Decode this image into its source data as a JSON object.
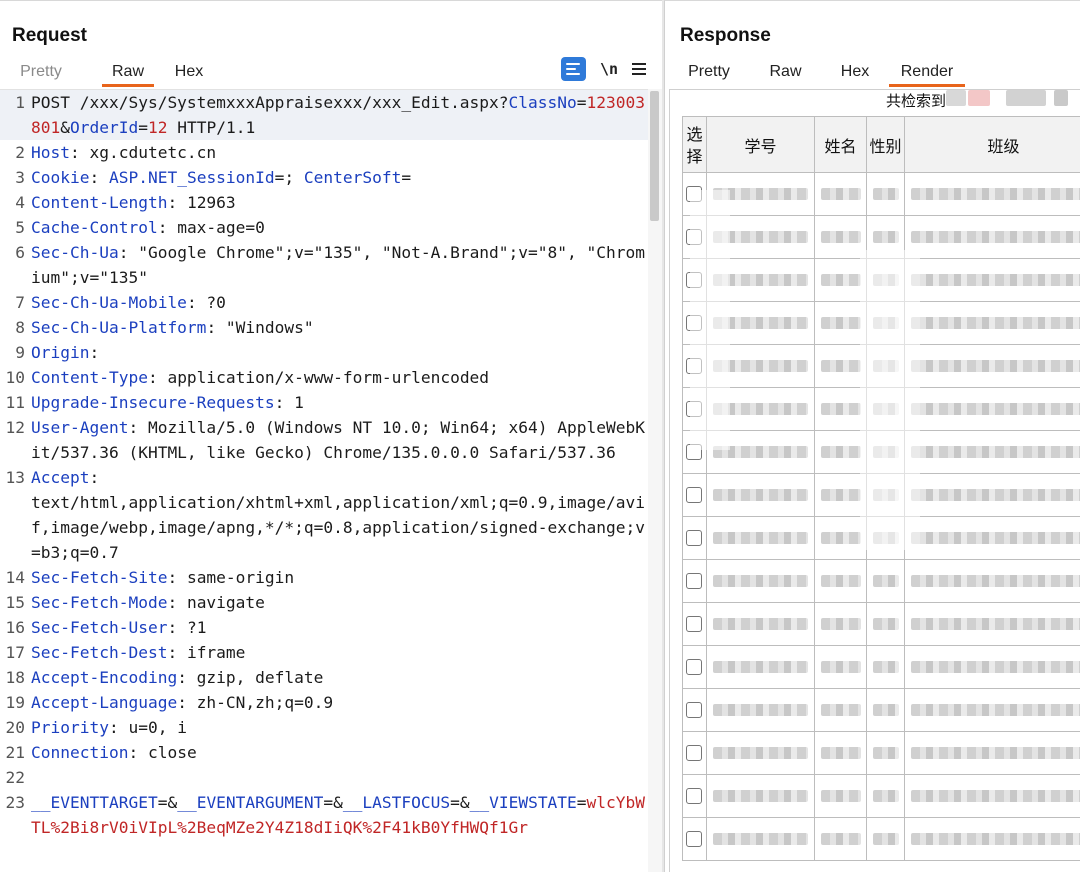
{
  "request": {
    "title": "Request",
    "tabs": [
      {
        "label": "Pretty",
        "state": "disabled"
      },
      {
        "label": "Raw",
        "state": "active"
      },
      {
        "label": "Hex",
        "state": "normal"
      }
    ],
    "toolbar": {
      "wrap_icon": "word-wrap-icon",
      "newline_label": "\\n",
      "menu_icon": "hamburger-menu-icon"
    },
    "lines": [
      {
        "n": "1",
        "parts": [
          [
            "t",
            "POST /xxx/Sys/SystemxxxAppraisexxx/xxx_Edit.aspx?"
          ],
          [
            "k",
            "ClassNo"
          ],
          [
            "t",
            "="
          ],
          [
            "r",
            "123003801"
          ],
          [
            "t",
            "&"
          ],
          [
            "k",
            "OrderId"
          ],
          [
            "t",
            "="
          ],
          [
            "r",
            "12"
          ],
          [
            "t",
            " HTTP/1.1"
          ]
        ]
      },
      {
        "n": "2",
        "parts": [
          [
            "k",
            "Host"
          ],
          [
            "t",
            ": xg.cdutetc.cn"
          ]
        ]
      },
      {
        "n": "3",
        "parts": [
          [
            "k",
            "Cookie"
          ],
          [
            "t",
            ": "
          ],
          [
            "k",
            "ASP.NET_SessionId"
          ],
          [
            "t",
            "=; "
          ],
          [
            "k",
            "CenterSoft"
          ],
          [
            "t",
            "="
          ]
        ]
      },
      {
        "n": "4",
        "parts": [
          [
            "k",
            "Content-Length"
          ],
          [
            "t",
            ": 12963"
          ]
        ]
      },
      {
        "n": "5",
        "parts": [
          [
            "k",
            "Cache-Control"
          ],
          [
            "t",
            ": max-age=0"
          ]
        ]
      },
      {
        "n": "6",
        "parts": [
          [
            "k",
            "Sec-Ch-Ua"
          ],
          [
            "t",
            ": \"Google Chrome\";v=\"135\", \"Not-A.Brand\";v=\"8\", \"Chromium\";v=\"135\""
          ]
        ]
      },
      {
        "n": "7",
        "parts": [
          [
            "k",
            "Sec-Ch-Ua-Mobile"
          ],
          [
            "t",
            ": ?0"
          ]
        ]
      },
      {
        "n": "8",
        "parts": [
          [
            "k",
            "Sec-Ch-Ua-Platform"
          ],
          [
            "t",
            ": \"Windows\""
          ]
        ]
      },
      {
        "n": "9",
        "parts": [
          [
            "k",
            "Origin"
          ],
          [
            "t",
            ":"
          ]
        ]
      },
      {
        "n": "10",
        "parts": [
          [
            "k",
            "Content-Type"
          ],
          [
            "t",
            ": application/x-www-form-urlencoded"
          ]
        ]
      },
      {
        "n": "11",
        "parts": [
          [
            "k",
            "Upgrade-Insecure-Requests"
          ],
          [
            "t",
            ": 1"
          ]
        ]
      },
      {
        "n": "12",
        "parts": [
          [
            "k",
            "User-Agent"
          ],
          [
            "t",
            ": Mozilla/5.0 (Windows NT 10.0; Win64; x64) AppleWebKit/537.36 (KHTML, like Gecko) Chrome/135.0.0.0 Safari/537.36"
          ]
        ]
      },
      {
        "n": "13",
        "parts": [
          [
            "k",
            "Accept"
          ],
          [
            "t",
            ":\ntext/html,application/xhtml+xml,application/xml;q=0.9,image/avif,image/webp,image/apng,*/*;q=0.8,application/signed-exchange;v=b3;q=0.7"
          ]
        ]
      },
      {
        "n": "14",
        "parts": [
          [
            "k",
            "Sec-Fetch-Site"
          ],
          [
            "t",
            ": same-origin"
          ]
        ]
      },
      {
        "n": "15",
        "parts": [
          [
            "k",
            "Sec-Fetch-Mode"
          ],
          [
            "t",
            ": navigate"
          ]
        ]
      },
      {
        "n": "16",
        "parts": [
          [
            "k",
            "Sec-Fetch-User"
          ],
          [
            "t",
            ": ?1"
          ]
        ]
      },
      {
        "n": "17",
        "parts": [
          [
            "k",
            "Sec-Fetch-Dest"
          ],
          [
            "t",
            ": iframe"
          ]
        ]
      },
      {
        "n": "18",
        "parts": [
          [
            "k",
            "Accept-Encoding"
          ],
          [
            "t",
            ": gzip, deflate"
          ]
        ]
      },
      {
        "n": "19",
        "parts": [
          [
            "k",
            "Accept-Language"
          ],
          [
            "t",
            ": zh-CN,zh;q=0.9"
          ]
        ]
      },
      {
        "n": "20",
        "parts": [
          [
            "k",
            "Priority"
          ],
          [
            "t",
            ": u=0, i"
          ]
        ]
      },
      {
        "n": "21",
        "parts": [
          [
            "k",
            "Connection"
          ],
          [
            "t",
            ": close"
          ]
        ]
      },
      {
        "n": "22",
        "parts": [
          [
            "t",
            ""
          ]
        ]
      },
      {
        "n": "23",
        "parts": [
          [
            "k",
            "__EVENTTARGET"
          ],
          [
            "t",
            "=&"
          ],
          [
            "k",
            "__EVENTARGUMENT"
          ],
          [
            "t",
            "=&"
          ],
          [
            "k",
            "__LASTFOCUS"
          ],
          [
            "t",
            "=&"
          ],
          [
            "k",
            "__VIEWSTATE"
          ],
          [
            "t",
            "="
          ],
          [
            "r",
            "wlcYbWTL%2Bi8rV0iVIpL%2BeqMZe2Y4Z18dIiQK%2F41kB0YfHWQf1Gr"
          ]
        ]
      }
    ]
  },
  "response": {
    "title": "Response",
    "tabs": [
      {
        "label": "Pretty",
        "state": "normal"
      },
      {
        "label": "Raw",
        "state": "normal"
      },
      {
        "label": "Hex",
        "state": "normal"
      },
      {
        "label": "Render",
        "state": "active"
      }
    ],
    "result_count_label": "共检索到",
    "table": {
      "headers": [
        "选择",
        "学号",
        "姓名",
        "性别",
        "班级"
      ],
      "row_count": 16
    }
  },
  "colors": {
    "accent": "#e8641b",
    "key": "#1b3fbf",
    "value": "#c02626",
    "wrap_button": "#2f7ad9"
  }
}
